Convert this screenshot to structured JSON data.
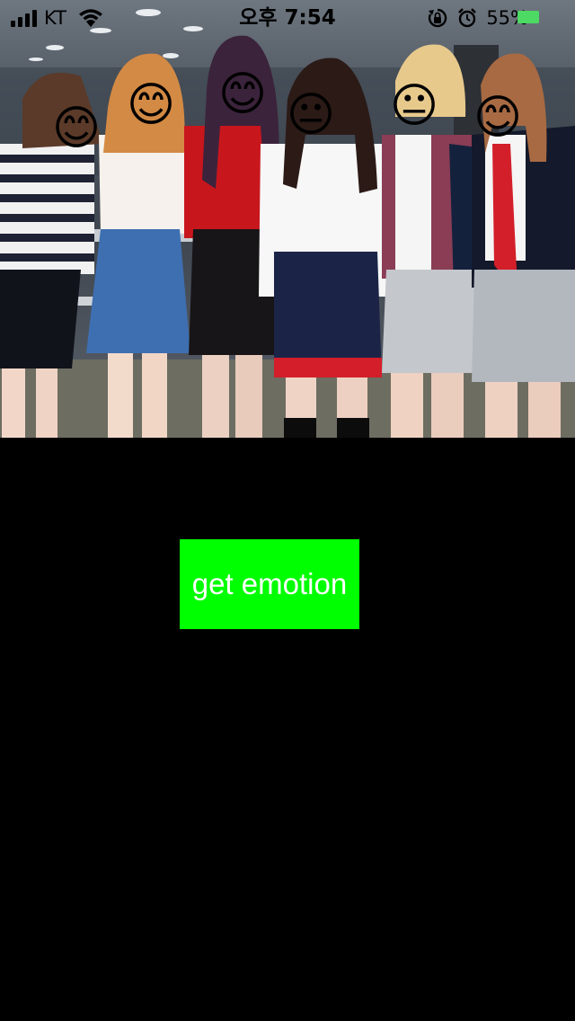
{
  "status_bar": {
    "carrier": "KT",
    "time": "오후 7:54",
    "battery_percent": "55%",
    "battery_level": 0.55,
    "icons": [
      "signal-icon",
      "wifi-icon",
      "orientation-lock-icon",
      "alarm-icon",
      "battery-icon"
    ]
  },
  "photo": {
    "people": 6,
    "face_emojis": [
      "😊",
      "😊",
      "😊",
      "😐",
      "😐",
      "😊"
    ]
  },
  "button": {
    "label": "get emotion",
    "background_color": "#00ff00",
    "text_color": "#ffffff"
  },
  "colors": {
    "background": "#000000",
    "battery": "#4cd964"
  }
}
